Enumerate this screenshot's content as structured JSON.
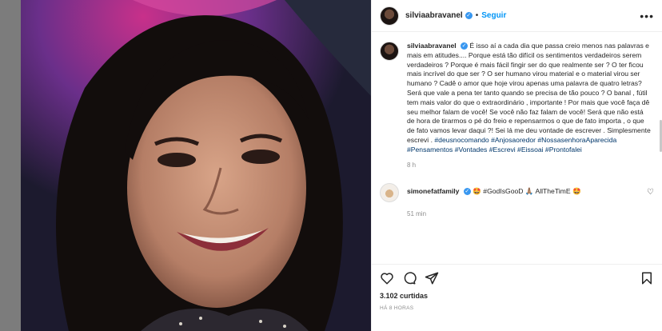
{
  "post": {
    "username": "silviaabravanel",
    "verified_mark": "✓",
    "separator": "•",
    "follow_label": "Seguir",
    "more_label": "•••",
    "caption_user": "silviaabravanel",
    "caption_body": "É isso aí a cada dia que passa creio menos nas palavras e mais em atitudes.... Porque está tão difícil os sentimentos verdadeiros serem verdadeiros ? Porque é mais fácil fingir ser do que realmente ser ? O ter ficou mais incrível do que ser ? O ser humano virou material e o material virou ser humano ? Cadê o amor que hoje virou apenas uma palavra de quatro letras? Será que vale a pena ter tanto quando se precisa de tão pouco ? O banal , fútil tem mais valor do que o extraordinário , importante ! Por mais que você faça dê seu melhor falam de você! Se você não faz falam de você! Será que não está de hora de tirarmos o pé do freio e repensarmos o que de fato importa , o que de fato vamos levar daqui ?! Sei lá me deu vontade de escrever . Simplesmente escrevi .",
    "hashtags": "#deusnocomando #Anjosaoredor #NossasenhoraAparecida #Pensamentos #Vontades #Escrevi #Eissoai #Prontofalei",
    "caption_time": "8 h",
    "likes": "3.102 curtidas",
    "posted_ago": "HÁ 8 HORAS"
  },
  "comment": {
    "username": "simonefatfamily",
    "verified_mark": "✓",
    "text": "🤩 #GodIsGooD 🙏🏽 AllTheTimE 🤩",
    "time": "51 min",
    "like_icon": "♡"
  },
  "icons": [
    "heart-icon",
    "comment-icon",
    "share-icon",
    "bookmark-icon"
  ],
  "colors": {
    "accent": "#0095f6",
    "verified": "#3897f0",
    "hashtag": "#00376b",
    "backdrop": "#7c7c7c"
  }
}
